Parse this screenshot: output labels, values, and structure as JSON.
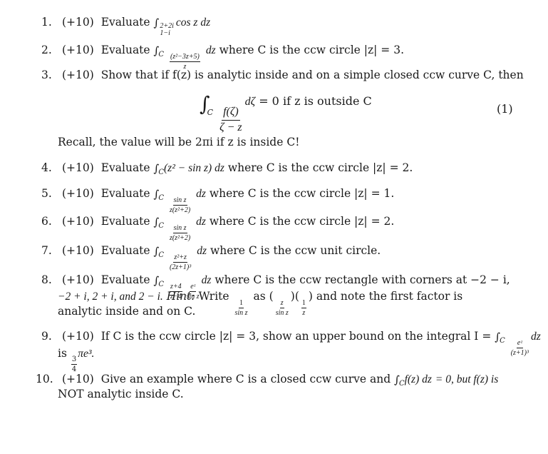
{
  "document": {
    "problems": [
      {
        "number": "1.",
        "points": "(+10)",
        "verb": "Evaluate",
        "integral": {
          "lower": "1−i",
          "upper": "2+2i",
          "integrand": "cos z dz"
        },
        "text_after": ""
      },
      {
        "number": "2.",
        "points": "(+10)",
        "verb": "Evaluate",
        "integral": {
          "contour": "C",
          "numerator": "(z²−3z+5)",
          "denominator": "z",
          "differential": "dz"
        },
        "text_after": "where C is the ccw circle |z| = 3."
      },
      {
        "number": "3.",
        "points": "(+10)",
        "text": "Show that if f(z) is analytic inside and on a simple closed ccw curve C, then",
        "display_equation": {
          "contour": "C",
          "numerator": "f(ζ)",
          "denominator": "ζ − z",
          "differential": "dζ",
          "rest": "= 0 if z is outside C",
          "label": "(1)"
        },
        "recall": "Recall, the value will be 2πi if z is inside C!"
      },
      {
        "number": "4.",
        "points": "(+10)",
        "verb": "Evaluate",
        "integral": {
          "contour": "C",
          "integrand": "(z² − sin z) dz"
        },
        "text_after": "where C is the ccw circle |z| = 2."
      },
      {
        "number": "5.",
        "points": "(+10)",
        "verb": "Evaluate",
        "integral": {
          "contour": "C",
          "numerator": "sin z",
          "denominator": "z(z²+2)",
          "differential": "dz"
        },
        "text_after": "where C is the ccw circle |z| = 1."
      },
      {
        "number": "6.",
        "points": "(+10)",
        "verb": "Evaluate",
        "integral": {
          "contour": "C",
          "numerator": "sin z",
          "denominator": "z(z²+2)",
          "differential": "dz"
        },
        "text_after": "where C is the ccw circle |z| = 2."
      },
      {
        "number": "7.",
        "points": "(+10)",
        "verb": "Evaluate",
        "integral": {
          "contour": "C",
          "numerator": "z²+z",
          "denominator": "(2z+1)³",
          "differential": "dz"
        },
        "text_after": "where C is the ccw unit circle."
      },
      {
        "number": "8.",
        "points": "(+10)",
        "verb": "Evaluate",
        "integral": {
          "contour": "C",
          "frac1_num": "z+4",
          "frac1_den": "z−4",
          "frac2_num": "eᶻ",
          "frac2_den": "sin z",
          "differential": "dz"
        },
        "line1_after": "where C is the ccw rectangle with corners at −2 − i,",
        "line2_start": "−2 + i, 2 + i, and 2 − i.",
        "hint_label": "Hint:",
        "hint_write": "Write",
        "hint_frac_num": "1",
        "hint_frac_den": "sin z",
        "hint_as": "as",
        "hint_f1_num": "z",
        "hint_f1_den": "sin z",
        "hint_f2_num": "1",
        "hint_f2_den": "z",
        "line2_end": "and note the first factor is",
        "line3": "analytic inside and on C."
      },
      {
        "number": "9.",
        "points": "(+10)",
        "line1_before": "If C is the ccw circle |z| = 3, show an upper bound on the integral I =",
        "integral": {
          "contour": "C",
          "numerator": "eᶻ",
          "denominator": "(z+1)³",
          "differential": "dz"
        },
        "line2_is": "is",
        "bound_num": "3",
        "bound_den": "4",
        "bound_rest": "πe³."
      },
      {
        "number": "10.",
        "points": "(+10)",
        "line1_before": "Give an example where C is a closed ccw curve and",
        "integral": {
          "contour": "C",
          "integrand": "f(z) dz"
        },
        "line1_after": "= 0, but f(z) is",
        "line2": "NOT analytic inside C."
      }
    ]
  }
}
